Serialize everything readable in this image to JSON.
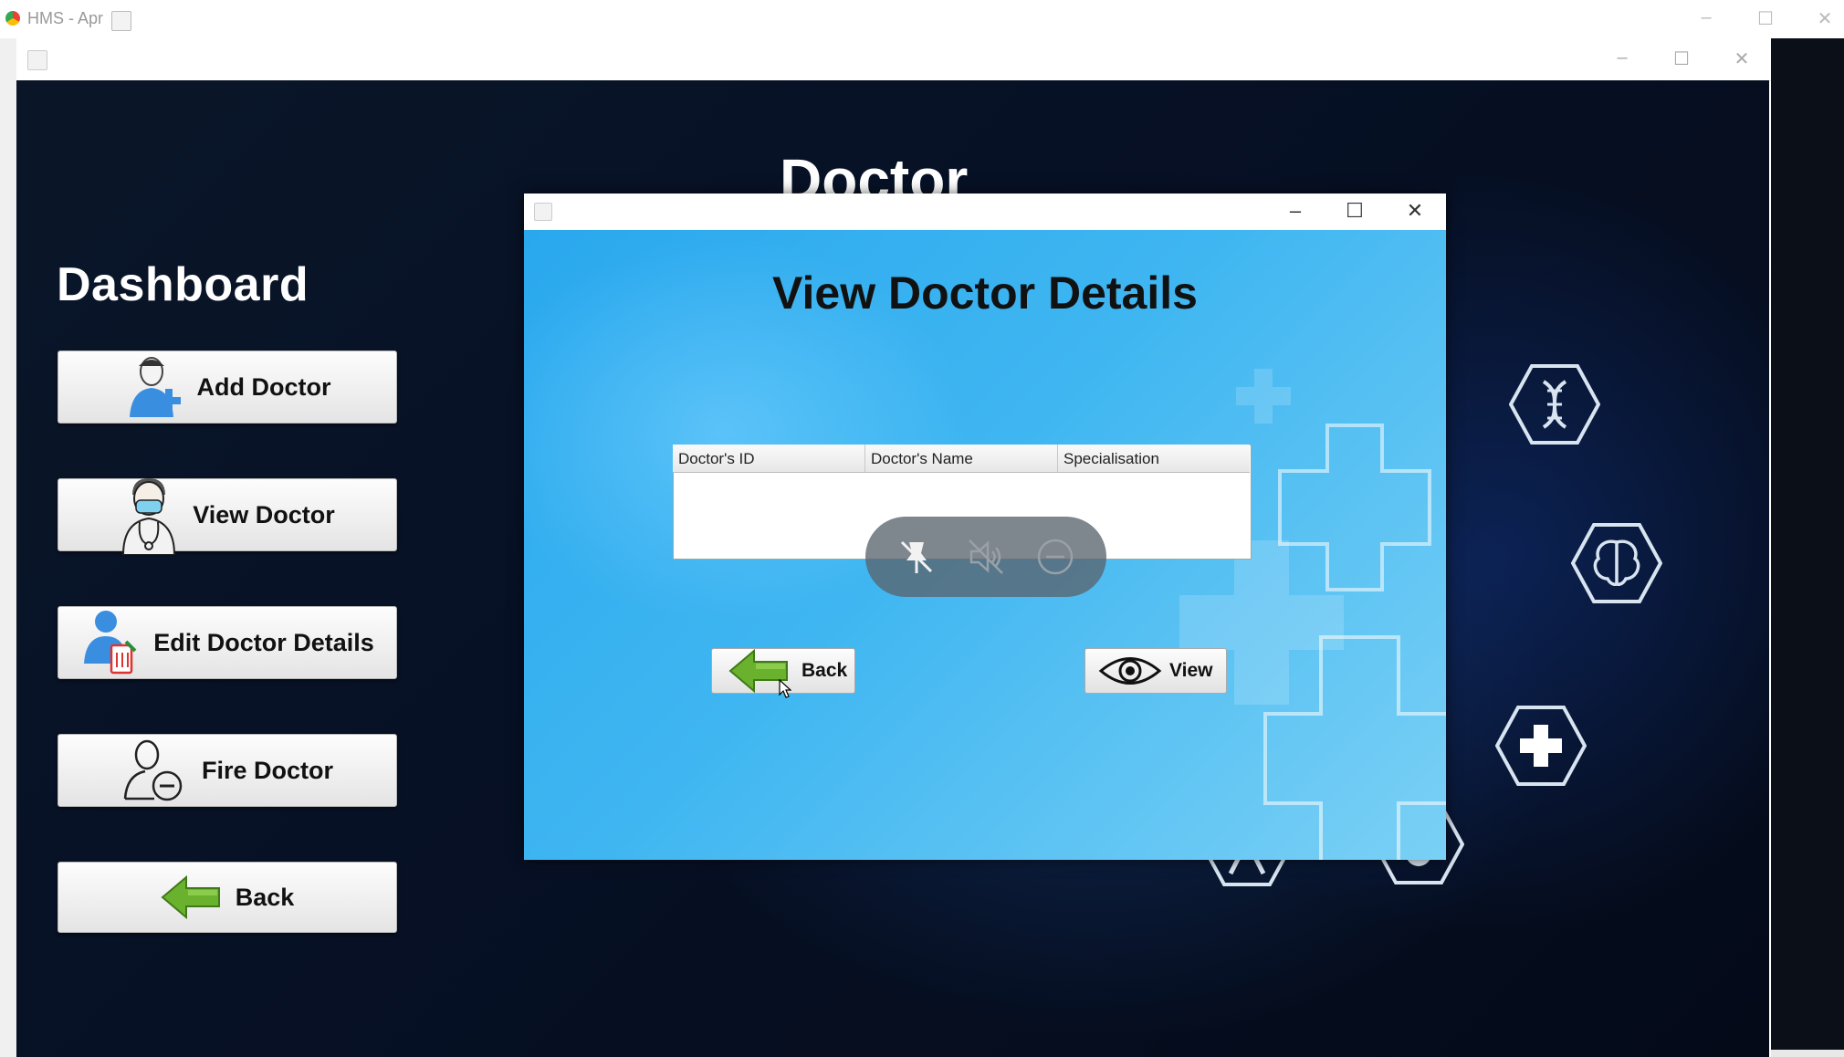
{
  "outer_window": {
    "title": "HMS - Apr",
    "app_icon": "chrome-icon",
    "java_icon": "java-icon"
  },
  "main_window": {
    "java_icon": "java-icon"
  },
  "window_controls": {
    "minimize": "–",
    "maximize": "☐",
    "close": "✕"
  },
  "dashboard": {
    "title": "Dashboard",
    "buttons": [
      {
        "label": "Add Doctor",
        "icon": "add-doctor-icon"
      },
      {
        "label": "View Doctor",
        "icon": "doctor-avatar-icon"
      },
      {
        "label": "Edit Doctor Details",
        "icon": "edit-doctor-icon"
      },
      {
        "label": "Fire Doctor",
        "icon": "remove-doctor-icon"
      },
      {
        "label": "Back",
        "icon": "back-arrow-icon"
      }
    ]
  },
  "doctor_header": "Doctor",
  "dialog": {
    "title": "View Doctor Details",
    "table": {
      "columns": [
        "Doctor's ID",
        "Doctor's Name",
        "Specialisation"
      ],
      "rows": []
    },
    "back_label": "Back",
    "view_label": "View",
    "overlay_icons": [
      "unpin-icon",
      "mute-icon",
      "minus-circle-icon"
    ]
  },
  "colors": {
    "dashboard_bg": "#071126",
    "dialog_bg": "#3fb6f1",
    "button_face": "#f0f0f0",
    "back_arrow": "#6ab12e"
  }
}
